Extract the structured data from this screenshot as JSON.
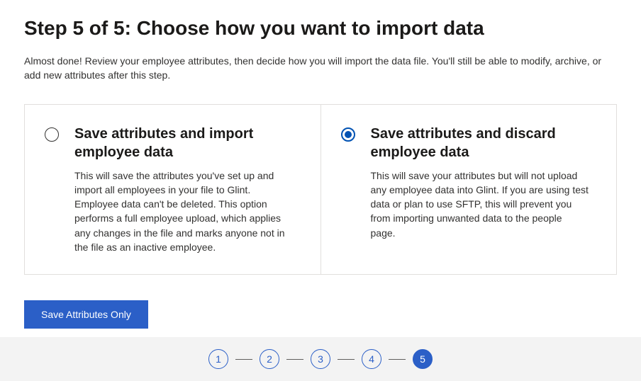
{
  "page": {
    "title": "Step 5 of 5: Choose how you want to import data",
    "description": "Almost done! Review your employee attributes, then decide how you will import the data file. You'll still be able to modify, archive, or add new attributes after this step."
  },
  "options": {
    "import": {
      "title": "Save attributes and import employee data",
      "description": "This will save the attributes you've set up and import all employees in your file to Glint. Employee data can't be deleted. This option performs a full employee upload, which applies any changes in the file and marks anyone not in the file as an inactive employee.",
      "selected": false
    },
    "discard": {
      "title": "Save attributes and discard employee data",
      "description": "This will save your attributes but will not upload any employee data into Glint. If you are using test data or plan to use SFTP, this will prevent you from importing unwanted data to the people page.",
      "selected": true
    }
  },
  "actions": {
    "primary": "Save Attributes Only"
  },
  "stepper": {
    "steps": [
      "1",
      "2",
      "3",
      "4",
      "5"
    ],
    "current": 5
  },
  "colors": {
    "primary": "#2b5fc7",
    "radioAccent": "#0052b3",
    "border": "#e1dfdd",
    "stepperBg": "#f3f3f3"
  }
}
